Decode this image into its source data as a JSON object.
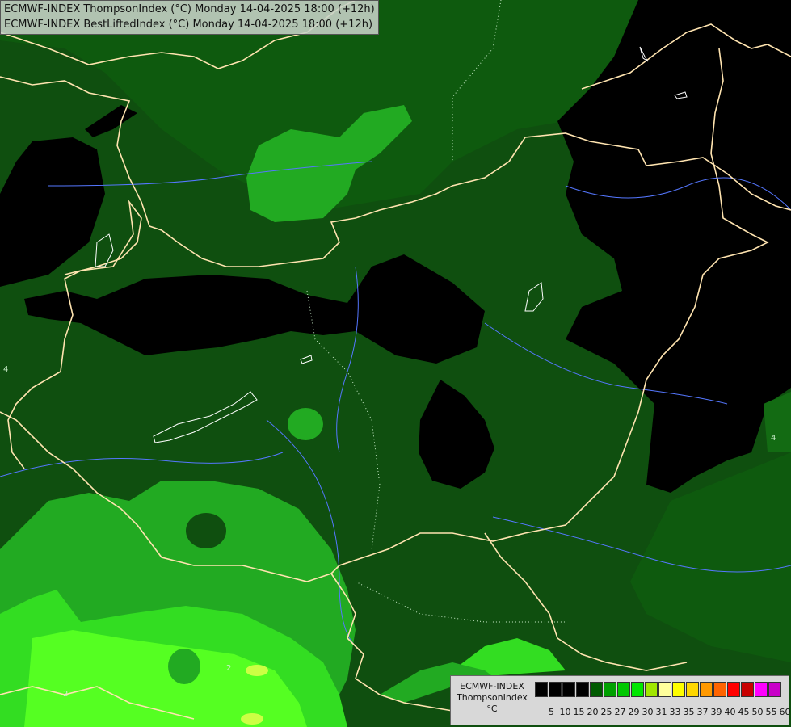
{
  "header": {
    "line1": "ECMWF-INDEX ThompsonIndex (°C) Monday 14-04-2025 18:00 (+12h)",
    "line2": "ECMWF-INDEX BestLiftedIndex (°C) Monday 14-04-2025 18:00 (+12h)"
  },
  "legend": {
    "title_line1": "ECMWF-INDEX",
    "title_line2": "ThompsonIndex",
    "unit": "°C",
    "colors": [
      "#000000",
      "#000000",
      "#000000",
      "#000000",
      "#005a00",
      "#00a000",
      "#00c800",
      "#00e600",
      "#a0e600",
      "#ffff9c",
      "#ffff00",
      "#ffd700",
      "#ff9900",
      "#ff6400",
      "#ff0000",
      "#c80000",
      "#ff00ff",
      "#c800c8",
      "#9600ff",
      "#6400ff",
      "#0000ff"
    ],
    "ticks": [
      "5",
      "10",
      "15",
      "20",
      "25",
      "27",
      "29",
      "30",
      "31",
      "33",
      "35",
      "37",
      "39",
      "40",
      "45",
      "50",
      "55",
      "60"
    ]
  },
  "map": {
    "field_colors": {
      "dark_green": "#0f4f0f",
      "mid_green": "#1a7a1a",
      "green": "#22aa22",
      "bright_green": "#33dd22",
      "lime": "#55ff22",
      "yellow_lime": "#ccff44",
      "black": "#000000",
      "border": "#ffe4b0",
      "river": "#5577ff"
    },
    "contour_labels": [
      "4",
      "2",
      "2",
      "4"
    ]
  }
}
